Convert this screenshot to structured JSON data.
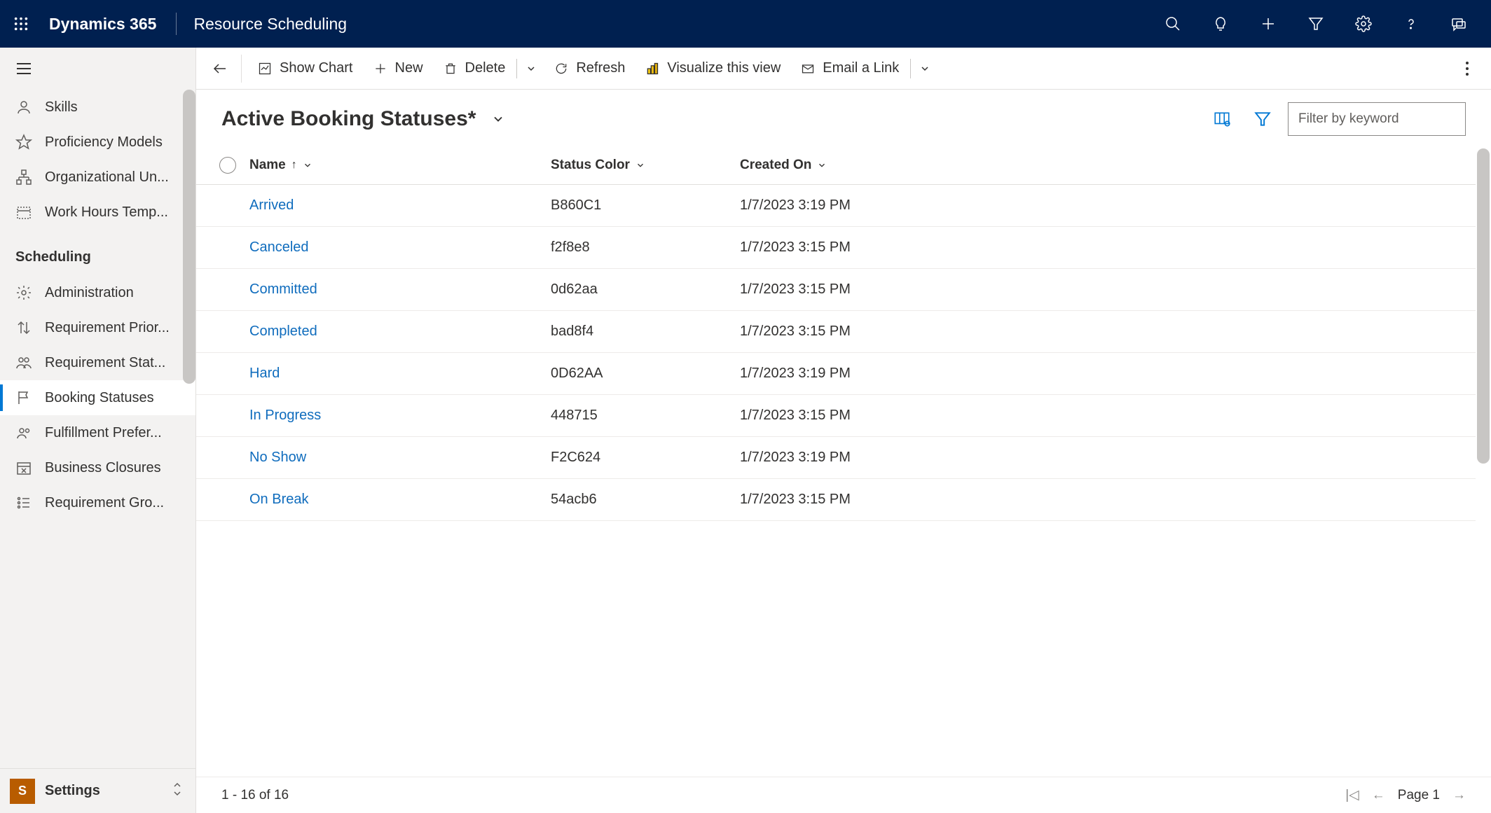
{
  "topbar": {
    "brand": "Dynamics 365",
    "app": "Resource Scheduling"
  },
  "sidebar": {
    "items_top": [
      {
        "label": "Skills",
        "icon": "person"
      },
      {
        "label": "Proficiency Models",
        "icon": "star"
      },
      {
        "label": "Organizational Un...",
        "icon": "org"
      },
      {
        "label": "Work Hours Temp...",
        "icon": "calendar-dotted"
      }
    ],
    "group_header": "Scheduling",
    "items_sched": [
      {
        "label": "Administration",
        "icon": "gear"
      },
      {
        "label": "Requirement Prior...",
        "icon": "priority"
      },
      {
        "label": "Requirement Stat...",
        "icon": "people"
      },
      {
        "label": "Booking Statuses",
        "icon": "flag",
        "active": true
      },
      {
        "label": "Fulfillment Prefer...",
        "icon": "people2"
      },
      {
        "label": "Business Closures",
        "icon": "closure"
      },
      {
        "label": "Requirement Gro...",
        "icon": "list"
      }
    ],
    "area_badge": "S",
    "area_label": "Settings"
  },
  "commands": {
    "show_chart": "Show Chart",
    "new": "New",
    "delete": "Delete",
    "refresh": "Refresh",
    "visualize": "Visualize this view",
    "email": "Email a Link"
  },
  "view": {
    "title": "Active Booking Statuses*",
    "filter_placeholder": "Filter by keyword"
  },
  "columns": {
    "name": "Name",
    "color": "Status Color",
    "created": "Created On"
  },
  "rows": [
    {
      "name": "Arrived",
      "color": "B860C1",
      "created": "1/7/2023 3:19 PM"
    },
    {
      "name": "Canceled",
      "color": "f2f8e8",
      "created": "1/7/2023 3:15 PM"
    },
    {
      "name": "Committed",
      "color": "0d62aa",
      "created": "1/7/2023 3:15 PM"
    },
    {
      "name": "Completed",
      "color": "bad8f4",
      "created": "1/7/2023 3:15 PM"
    },
    {
      "name": "Hard",
      "color": "0D62AA",
      "created": "1/7/2023 3:19 PM"
    },
    {
      "name": "In Progress",
      "color": "448715",
      "created": "1/7/2023 3:15 PM"
    },
    {
      "name": "No Show",
      "color": "F2C624",
      "created": "1/7/2023 3:19 PM"
    },
    {
      "name": "On Break",
      "color": "54acb6",
      "created": "1/7/2023 3:15 PM"
    }
  ],
  "status": {
    "range": "1 - 16 of 16",
    "page": "Page 1"
  }
}
